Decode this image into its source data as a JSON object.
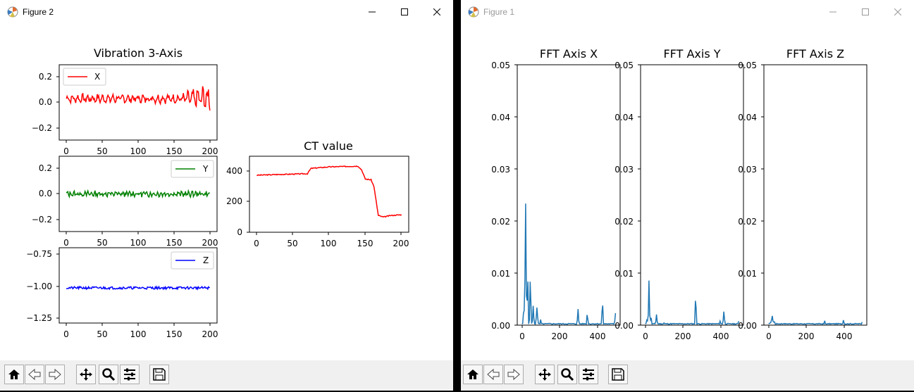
{
  "windows": {
    "figure2": {
      "title": "Figure 2"
    },
    "figure1": {
      "title": "Figure 1"
    }
  },
  "icons": {
    "app": "matplotlib-icon",
    "minimize": "minimize-icon",
    "maximize": "maximize-icon",
    "close": "close-icon",
    "home": "home-icon",
    "back": "back-arrow-icon",
    "forward": "forward-arrow-icon",
    "pan": "move-icon",
    "zoom": "zoom-icon",
    "configure": "sliders-icon",
    "save": "save-icon"
  },
  "colors": {
    "red": "#ff0000",
    "green": "#008000",
    "blue": "#0000ff",
    "fft": "#1f77b4",
    "inactive_title": "#999999"
  },
  "chart_data": [
    {
      "id": "vib-x",
      "type": "line",
      "title": "Vibration 3-Axis",
      "xlim": [
        -10,
        210
      ],
      "ylim": [
        -0.3,
        0.3
      ],
      "xticks": [
        "0",
        "50",
        "100",
        "150",
        "200"
      ],
      "yticks": [
        "0.2",
        "0.0",
        "−0.2"
      ],
      "legend": "X",
      "legend_loc": "upper left",
      "series": [
        {
          "name": "X",
          "x_range": [
            0,
            200
          ],
          "approx": "oscillation about 0.03, growing to ±0.1 near x=170-200"
        }
      ]
    },
    {
      "id": "vib-y",
      "type": "line",
      "xlim": [
        -10,
        210
      ],
      "ylim": [
        -0.3,
        0.3
      ],
      "xticks": [
        "0",
        "50",
        "100",
        "150",
        "200"
      ],
      "yticks": [
        "0.2",
        "0.0",
        "−0.2"
      ],
      "legend": "Y",
      "legend_loc": "upper right",
      "series": [
        {
          "name": "Y",
          "x_range": [
            0,
            200
          ],
          "approx": "oscillation about 0.0, ±0.03"
        }
      ]
    },
    {
      "id": "vib-z",
      "type": "line",
      "xlim": [
        -10,
        210
      ],
      "ylim": [
        -1.3,
        -0.7
      ],
      "xticks": [
        "0",
        "50",
        "100",
        "150",
        "200"
      ],
      "yticks": [
        "−0.75",
        "−1.00",
        "−1.25"
      ],
      "legend": "Z",
      "legend_loc": "upper right",
      "series": [
        {
          "name": "Z",
          "x_range": [
            0,
            200
          ],
          "approx": "flat around −1.02"
        }
      ]
    },
    {
      "id": "ct",
      "type": "line",
      "title": "CT value",
      "xlim": [
        -10,
        210
      ],
      "ylim": [
        0,
        500
      ],
      "xticks": [
        "0",
        "50",
        "100",
        "150",
        "200"
      ],
      "yticks": [
        "400",
        "200",
        "0"
      ],
      "series": [
        {
          "keypoints": [
            [
              0,
              375
            ],
            [
              30,
              380
            ],
            [
              70,
              385
            ],
            [
              75,
              420
            ],
            [
              100,
              430
            ],
            [
              140,
              435
            ],
            [
              145,
              410
            ],
            [
              150,
              350
            ],
            [
              158,
              345
            ],
            [
              162,
              300
            ],
            [
              168,
              110
            ],
            [
              175,
              100
            ],
            [
              185,
              110
            ],
            [
              200,
              115
            ]
          ]
        }
      ]
    },
    {
      "id": "fft-x",
      "type": "line",
      "title": "FFT Axis X",
      "xlim": [
        -25,
        525
      ],
      "ylim": [
        0,
        0.05
      ],
      "xticks": [
        "0",
        "200",
        "400"
      ],
      "yticks": [
        "0.05",
        "0.04",
        "0.03",
        "0.02",
        "0.01",
        "0.00"
      ],
      "series": [
        {
          "peaks": [
            [
              10,
              0.004
            ],
            [
              20,
              0.03
            ],
            [
              30,
              0.011
            ],
            [
              45,
              0.01
            ],
            [
              60,
              0.004
            ],
            [
              80,
              0.005
            ],
            [
              100,
              0.001
            ],
            [
              150,
              0.0005
            ],
            [
              250,
              0.0005
            ],
            [
              300,
              0.003
            ],
            [
              350,
              0.003
            ],
            [
              430,
              0.005
            ],
            [
              500,
              0.003
            ]
          ]
        }
      ]
    },
    {
      "id": "fft-y",
      "type": "line",
      "title": "FFT Axis Y",
      "xlim": [
        -25,
        525
      ],
      "ylim": [
        0,
        0.05
      ],
      "xticks": [
        "0",
        "200",
        "400"
      ],
      "yticks": [
        "0.05",
        "0.04",
        "0.03",
        "0.02",
        "0.01",
        "0.00"
      ],
      "series": [
        {
          "peaks": [
            [
              10,
              0.002
            ],
            [
              20,
              0.0085
            ],
            [
              30,
              0.002
            ],
            [
              60,
              0.0025
            ],
            [
              100,
              0.0005
            ],
            [
              200,
              0.0003
            ],
            [
              270,
              0.0067
            ],
            [
              280,
              0.0003
            ],
            [
              400,
              0.001
            ],
            [
              420,
              0.0033
            ],
            [
              500,
              0.001
            ]
          ]
        }
      ]
    },
    {
      "id": "fft-z",
      "type": "line",
      "title": "FFT Axis Z",
      "xlim": [
        -25,
        525
      ],
      "ylim": [
        0,
        0.05
      ],
      "xticks": [
        "0",
        "200",
        "400"
      ],
      "yticks": [
        "0.05",
        "0.04",
        "0.03",
        "0.02",
        "0.01",
        "0.00"
      ],
      "series": [
        {
          "peaks": [
            [
              10,
              0.001
            ],
            [
              20,
              0.0028
            ],
            [
              30,
              0.001
            ],
            [
              80,
              0.0005
            ],
            [
              150,
              0.0002
            ],
            [
              250,
              0.0004
            ],
            [
              300,
              0.0008
            ],
            [
              400,
              0.0014
            ],
            [
              500,
              0.0008
            ]
          ]
        }
      ]
    }
  ]
}
